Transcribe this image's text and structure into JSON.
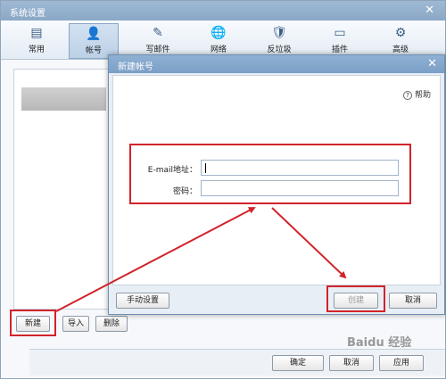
{
  "window": {
    "title": "系统设置",
    "close_glyph": "✕"
  },
  "toolbar": {
    "items": [
      {
        "label": "常用",
        "icon": "▤"
      },
      {
        "label": "帐号",
        "icon": "👤"
      },
      {
        "label": "写邮件",
        "icon": "✎"
      },
      {
        "label": "网络",
        "icon": "🌐"
      },
      {
        "label": "反垃圾",
        "icon": "🛡"
      },
      {
        "label": "插件",
        "icon": "▭"
      },
      {
        "label": "高级",
        "icon": "⚙"
      }
    ]
  },
  "accounts": {
    "new_label": "新建",
    "import_label": "导入",
    "delete_label": "删除"
  },
  "footer": {
    "ok_label": "确定",
    "cancel_label": "取消",
    "apply_label": "应用"
  },
  "dialog": {
    "title": "新建帐号",
    "close_glyph": "✕",
    "help_label": "帮助",
    "email_label": "E-mail地址：",
    "email_value": "",
    "password_label": "密码：",
    "password_value": "",
    "manual_label": "手动设置",
    "create_label": "创建",
    "cancel_label": "取消"
  },
  "watermark": "Baidu 经验",
  "colors": {
    "highlight_red": "#d2232a",
    "title_blue": "#8aa8c6"
  }
}
